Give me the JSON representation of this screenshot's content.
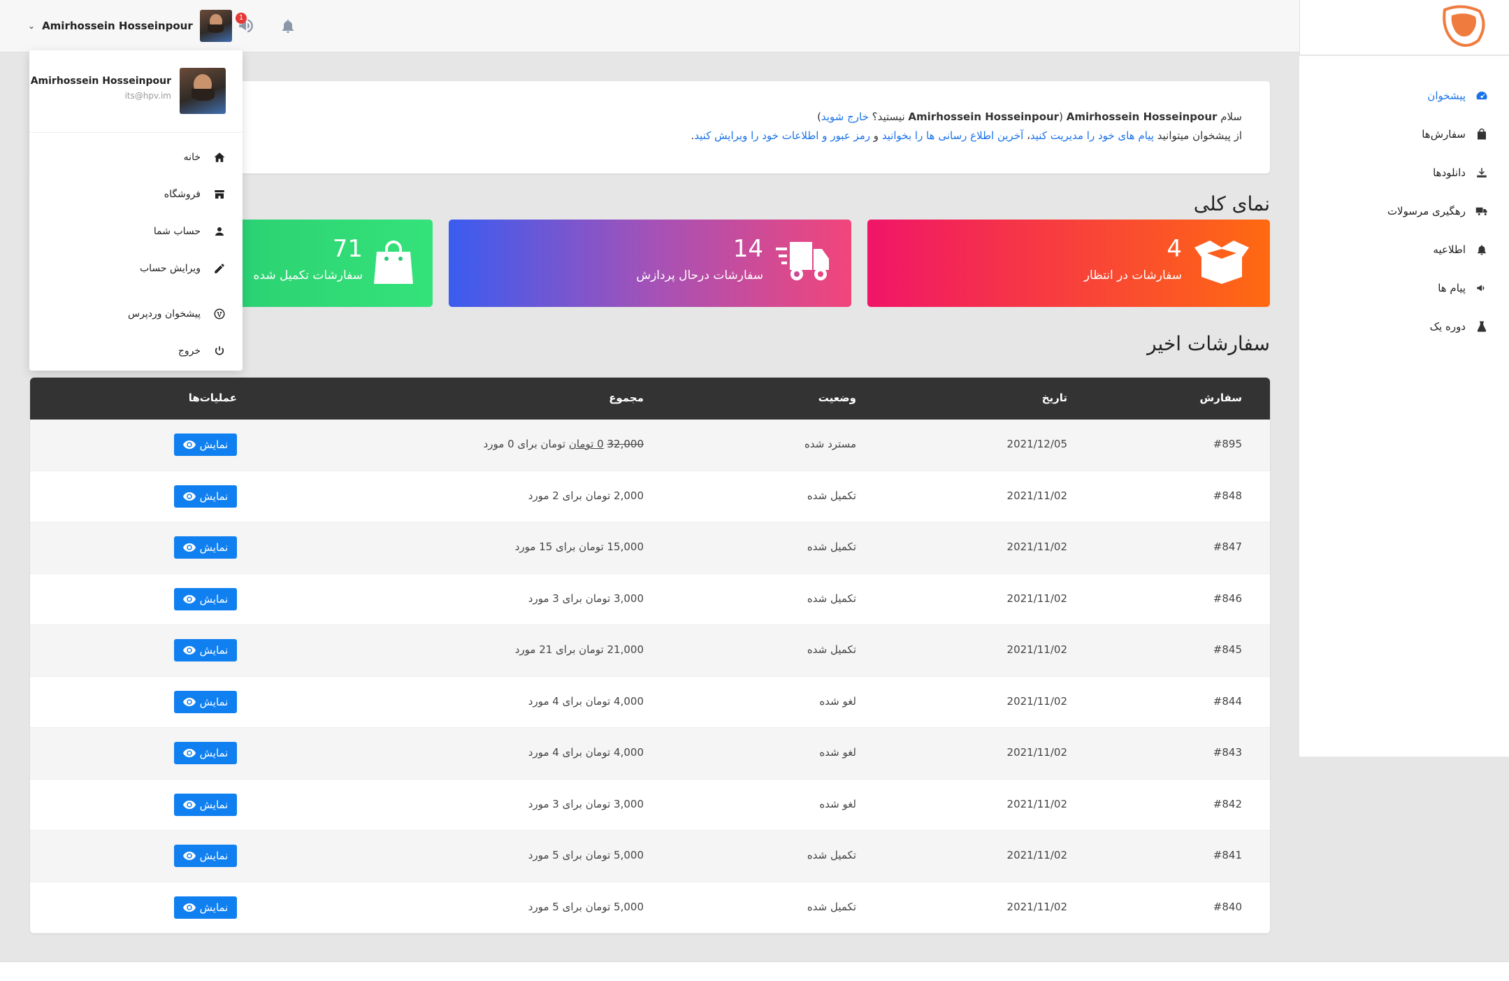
{
  "colors": {
    "accent": "#1a73e8",
    "logo": "#f07b3f",
    "header_bg": "#333333"
  },
  "header": {
    "username": "Amirhossein Hosseinpour",
    "notification_count": "1"
  },
  "dropdown": {
    "name": "Amirhossein Hosseinpour",
    "email": "its@hpv.im",
    "items": [
      {
        "label": "خانه",
        "icon": "home-icon"
      },
      {
        "label": "فروشگاه",
        "icon": "store-icon"
      },
      {
        "label": "حساب شما",
        "icon": "user-icon"
      },
      {
        "label": "ویرایش حساب",
        "icon": "pencil-icon"
      },
      {
        "label": "پیشخوان وردپرس",
        "icon": "wordpress-icon"
      },
      {
        "label": "خروج",
        "icon": "power-icon"
      }
    ]
  },
  "sidebar": {
    "items": [
      {
        "label": "پیشخوان",
        "icon": "dashboard-icon"
      },
      {
        "label": "سفارش‌ها",
        "icon": "bag-icon"
      },
      {
        "label": "دانلودها",
        "icon": "download-icon"
      },
      {
        "label": "رهگیری مرسولات",
        "icon": "truck-icon"
      },
      {
        "label": "اطلاعیه",
        "icon": "bell-icon"
      },
      {
        "label": "پیام ها",
        "icon": "megaphone-icon"
      },
      {
        "label": "دوره یک",
        "icon": "flask-icon"
      }
    ]
  },
  "welcome": {
    "hello": "سلام",
    "name1": "Amirhossein Hosseinpour",
    "not_you_prefix": "(",
    "name2": "Amirhossein Hosseinpour",
    "not_you": "نیستید؟",
    "logout": "خارج شوید",
    "close_paren": ")",
    "line2_a": "از پیشخوان میتوانید",
    "link_messages": "پیام های خود را مدیریت کنید",
    "comma": "،",
    "link_notices": "آخرین اطلاع رسانی ها را بخوانید",
    "and": "و",
    "link_account": "رمز عبور و اطلاعات خود را ویرایش کنید",
    "dot": "."
  },
  "overview": {
    "title": "نمای کلی",
    "cards": [
      {
        "number": "4",
        "label": "سفارشات در انتظار"
      },
      {
        "number": "14",
        "label": "سفارشات درحال پردازش"
      },
      {
        "number": "71",
        "label": "سفارشات تکمیل شده"
      }
    ]
  },
  "recent": {
    "title": "سفارشات اخیر",
    "columns": {
      "order": "سفارش",
      "date": "تاریخ",
      "status": "وضعیت",
      "total": "مجموع",
      "actions": "عملیات‌ها"
    },
    "view_label": "نمایش",
    "rows": [
      {
        "order": "#895",
        "date": "2021/12/05",
        "status": "مسترد شده",
        "total_old": "32,000",
        "total": "0 تومان",
        "suffix": "تومان برای 0 مورد",
        "refunded": true
      },
      {
        "order": "#848",
        "date": "2021/11/02",
        "status": "تکمیل شده",
        "total": "2,000 تومان برای 2 مورد"
      },
      {
        "order": "#847",
        "date": "2021/11/02",
        "status": "تکمیل شده",
        "total": "15,000 تومان برای 15 مورد"
      },
      {
        "order": "#846",
        "date": "2021/11/02",
        "status": "تکمیل شده",
        "total": "3,000 تومان برای 3 مورد"
      },
      {
        "order": "#845",
        "date": "2021/11/02",
        "status": "تکمیل شده",
        "total": "21,000 تومان برای 21 مورد"
      },
      {
        "order": "#844",
        "date": "2021/11/02",
        "status": "لغو شده",
        "total": "4,000 تومان برای 4 مورد"
      },
      {
        "order": "#843",
        "date": "2021/11/02",
        "status": "لغو شده",
        "total": "4,000 تومان برای 4 مورد"
      },
      {
        "order": "#842",
        "date": "2021/11/02",
        "status": "لغو شده",
        "total": "3,000 تومان برای 3 مورد"
      },
      {
        "order": "#841",
        "date": "2021/11/02",
        "status": "تکمیل شده",
        "total": "5,000 تومان برای 5 مورد"
      },
      {
        "order": "#840",
        "date": "2021/11/02",
        "status": "تکمیل شده",
        "total": "5,000 تومان برای 5 مورد"
      }
    ]
  }
}
